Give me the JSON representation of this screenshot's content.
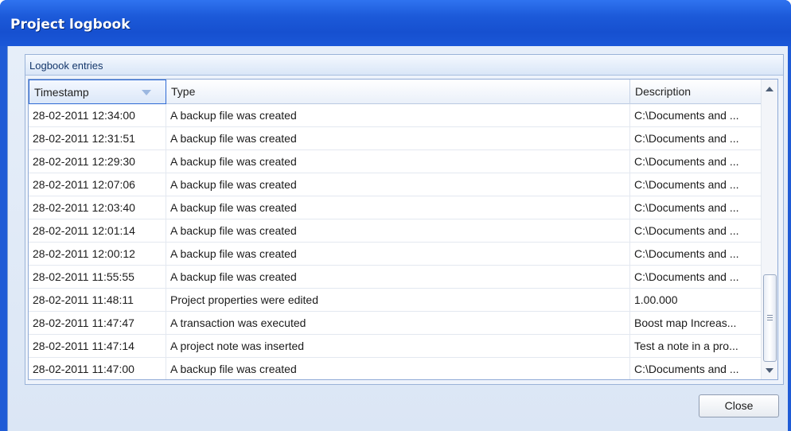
{
  "window": {
    "title": "Project logbook"
  },
  "groupbox": {
    "title": "Logbook entries"
  },
  "grid": {
    "columns": {
      "timestamp": "Timestamp",
      "type": "Type",
      "description": "Description"
    },
    "sorted_column": "Timestamp",
    "rows": [
      {
        "timestamp": "28-02-2011 12:34:00",
        "type": "A backup file was created",
        "description": "C:\\Documents and ..."
      },
      {
        "timestamp": "28-02-2011 12:31:51",
        "type": "A backup file was created",
        "description": "C:\\Documents and ..."
      },
      {
        "timestamp": "28-02-2011 12:29:30",
        "type": "A backup file was created",
        "description": "C:\\Documents and ..."
      },
      {
        "timestamp": "28-02-2011 12:07:06",
        "type": "A backup file was created",
        "description": "C:\\Documents and ..."
      },
      {
        "timestamp": "28-02-2011 12:03:40",
        "type": "A backup file was created",
        "description": "C:\\Documents and ..."
      },
      {
        "timestamp": "28-02-2011 12:01:14",
        "type": "A backup file was created",
        "description": "C:\\Documents and ..."
      },
      {
        "timestamp": "28-02-2011 12:00:12",
        "type": "A backup file was created",
        "description": "C:\\Documents and ..."
      },
      {
        "timestamp": "28-02-2011 11:55:55",
        "type": "A backup file was created",
        "description": "C:\\Documents and ..."
      },
      {
        "timestamp": "28-02-2011 11:48:11",
        "type": "Project properties were edited",
        "description": "1.00.000"
      },
      {
        "timestamp": "28-02-2011 11:47:47",
        "type": "A transaction was executed",
        "description": "Boost map Increas..."
      },
      {
        "timestamp": "28-02-2011 11:47:14",
        "type": "A project note was inserted",
        "description": "Test a note in a pro..."
      },
      {
        "timestamp": "28-02-2011 11:47:00",
        "type": "A backup file was created",
        "description": "C:\\Documents and ..."
      }
    ]
  },
  "buttons": {
    "close_label": "Close"
  },
  "icons": {
    "sort": "sort-descending-icon",
    "scroll_up": "arrow-up-icon",
    "scroll_down": "arrow-down-icon",
    "grip": "scroll-grip-icon"
  },
  "colors": {
    "titlebar": "#1c5ad9",
    "client": "#dbe6f5",
    "selected_header_border": "#2f6ad4"
  }
}
